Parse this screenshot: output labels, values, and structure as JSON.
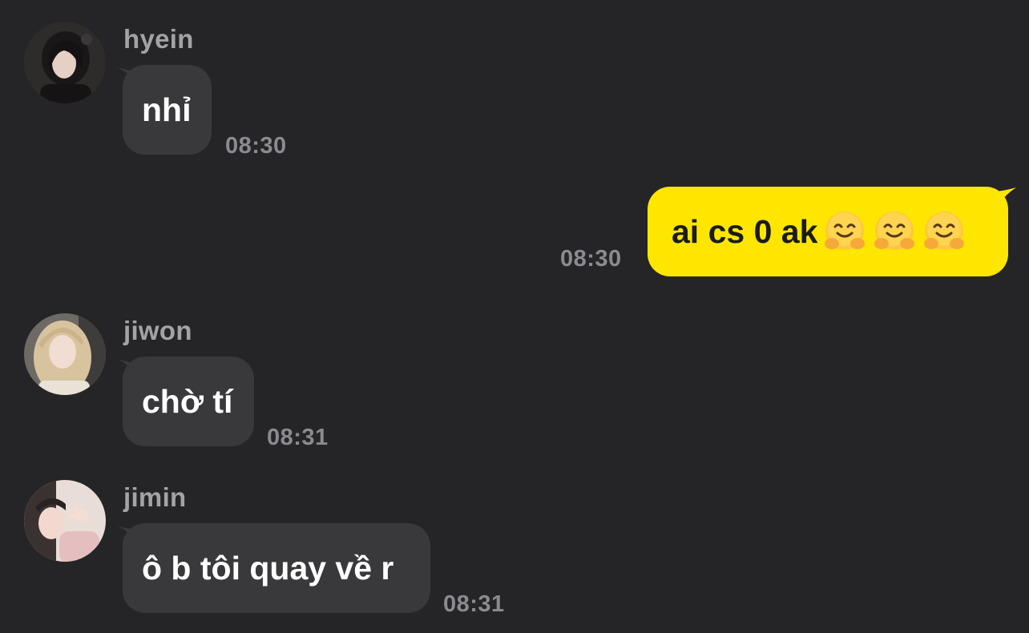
{
  "messages": [
    {
      "sender": "hyein",
      "text": "nhỉ",
      "time": "08:30",
      "avatar_icon": "user-photo-dark-hair"
    },
    {
      "sender": "me",
      "text": "ai cs 0 ak",
      "emojis": [
        "hugging-face",
        "hugging-face",
        "hugging-face"
      ],
      "time": "08:30"
    },
    {
      "sender": "jiwon",
      "text": "chờ tí",
      "time": "08:31",
      "avatar_icon": "user-photo-blonde-hair"
    },
    {
      "sender": "jimin",
      "text": "ô b tôi quay về r",
      "time": "08:31",
      "avatar_icon": "user-photo-peace-sign"
    }
  ],
  "colors": {
    "background": "#252527",
    "incoming_bubble": "#39393c",
    "outgoing_bubble": "#ffe600",
    "sender_name": "#a3a3a6",
    "timestamp": "#8b8b8f"
  }
}
